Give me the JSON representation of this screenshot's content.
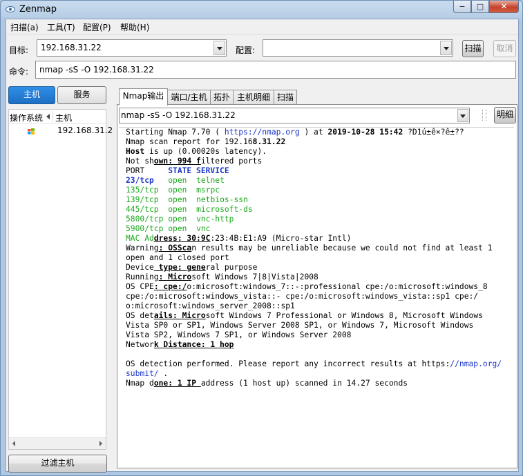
{
  "window": {
    "title": "Zenmap",
    "minimize": "−",
    "maximize": "□",
    "close": "✕"
  },
  "menu": [
    {
      "label": "扫描(a)"
    },
    {
      "label": "工具(T)"
    },
    {
      "label": "配置(P)"
    },
    {
      "label": "帮助(H)"
    }
  ],
  "target": {
    "label": "目标:",
    "value": "192.168.31.22"
  },
  "profile": {
    "label": "配置:",
    "value": ""
  },
  "scan_button": "扫描",
  "cancel_button": "取消",
  "command": {
    "label": "命令:",
    "value": "nmap -sS -O 192.168.31.22"
  },
  "left": {
    "hosts_button": "主机",
    "services_button": "服务",
    "col_os": "操作系统",
    "col_host": "主机",
    "hosts": [
      {
        "ip": "192.168.31.2"
      }
    ],
    "filter_button": "过滤主机"
  },
  "tabs": [
    {
      "label": "Nmap输出",
      "active": true
    },
    {
      "label": "端口/主机",
      "active": false
    },
    {
      "label": "拓扑",
      "active": false
    },
    {
      "label": "主机明细",
      "active": false
    },
    {
      "label": "扫描",
      "active": false
    }
  ],
  "output_command": "nmap -sS -O 192.168.31.22",
  "details_button": "明细",
  "output": {
    "l1a": "Starting Nmap 7.70 ( ",
    "l1url": "https://nmap.org",
    "l1b": " ) at ",
    "l1date": "2019-10-28 15:42",
    "l1c": " ?D1ú±ê×?ê±??",
    "l2a": "Nmap scan report for 192.16",
    "l2b": "8.31.22",
    "l3a": "Host",
    "l3b": " is up (0.00020s latency).",
    "l4a": "Not sh",
    "l4b": "own: 994 f",
    "l4c": "iltered ports",
    "port_header_a": "PORT     ",
    "port_header_b": "STATE SERVICE",
    "ports": [
      {
        "port": "23/tcp  ",
        "state": "open",
        "service": "telnet"
      },
      {
        "port": "135/tcp ",
        "state": "open",
        "service": "msrpc"
      },
      {
        "port": "139/tcp ",
        "state": "open",
        "service": "netbios-ssn"
      },
      {
        "port": "445/tcp ",
        "state": "open",
        "service": "microsoft-ds"
      },
      {
        "port": "5800/tcp",
        "state": "open",
        "service": "vnc-http"
      },
      {
        "port": "5900/tcp",
        "state": "open",
        "service": "vnc"
      }
    ],
    "mac_a": "MAC Ad",
    "mac_b": "dress: 30:9C",
    "mac_c": ":23:4B:E1:A9 (Micro-star Intl)",
    "warn_a": "Warning",
    "warn_b": ": OSSca",
    "warn_c": "n results may be unreliable because we could not find at least 1",
    "warn_d": "open and 1 closed port",
    "dev_a": "Device",
    "dev_b": " type: gene",
    "dev_c": "ral purpose",
    "run_a": "Running",
    "run_b": ": Micro",
    "run_c": "soft Windows 7|8|Vista|2008",
    "cpe_a": "OS CPE",
    "cpe_b": ": cpe:/",
    "cpe_c": "o:microsoft:windows_7::-:professional cpe:/o:microsoft:windows_8",
    "cpe_d": "cpe:/o:microsoft:windows_vista::- cpe:/o:microsoft:windows_vista::sp1 cpe:/",
    "cpe_e": "o:microsoft:windows_server_2008::sp1",
    "osd_a": "OS det",
    "osd_b": "ails: Micro",
    "osd_c": "soft Windows 7 Professional or Windows 8, Microsoft Windows",
    "osd_d": "Vista SP0 or SP1, Windows Server 2008 SP1, or Windows 7, Microsoft Windows",
    "osd_e": "Vista SP2, Windows 7 SP1, or Windows Server 2008",
    "net_a": "Networ",
    "net_b": "k Distance: 1 hop",
    "det_a": "OS detection performed. Please report any incorrect results at https:",
    "det_b": "//nmap.org/",
    "det_c": "submit/",
    "det_d": " .",
    "done_a": "Nmap d",
    "done_b": "one: 1 IP ",
    "done_c": "address (1 host up) scanned in 14.27 seconds"
  }
}
